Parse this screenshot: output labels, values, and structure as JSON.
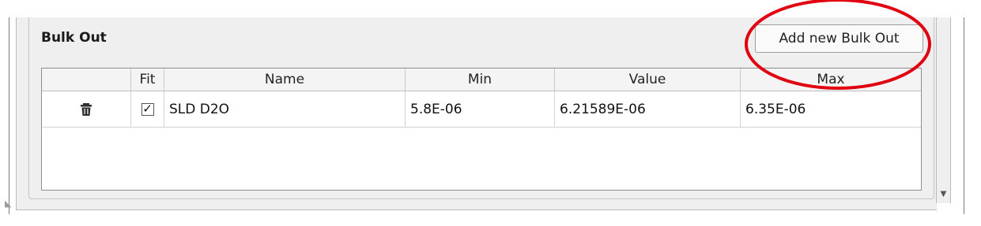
{
  "section": {
    "title": "Bulk Out"
  },
  "toolbar": {
    "add_label": "Add new Bulk Out"
  },
  "table": {
    "headers": {
      "delete": "",
      "fit": "Fit",
      "name": "Name",
      "min": "Min",
      "value": "Value",
      "max": "Max"
    },
    "rows": [
      {
        "fit_checked": "✓",
        "name": "SLD D2O",
        "min": "5.8E-06",
        "value": "6.21589E-06",
        "max": "6.35E-06"
      }
    ]
  },
  "icons": {
    "delete": "trash-icon",
    "scroll_down": "scroll-down-arrow-icon",
    "resize": "resize-grip-icon"
  },
  "colors": {
    "annotation": "#e0000f"
  }
}
